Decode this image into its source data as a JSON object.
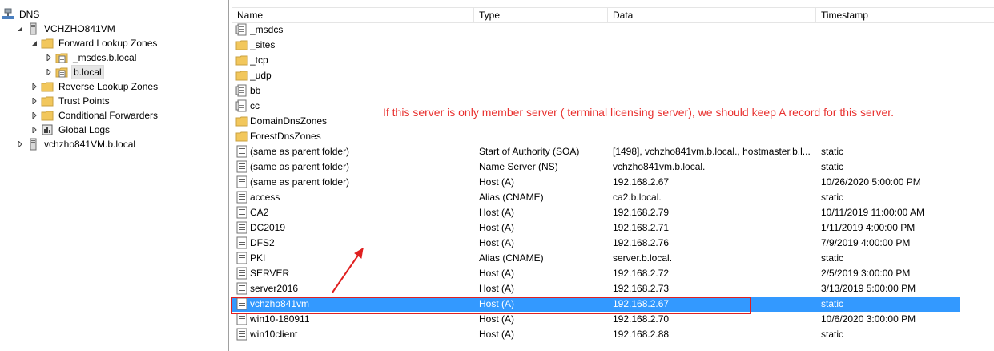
{
  "tree": {
    "root": "DNS",
    "server": "VCHZHO841VM",
    "forward_zones": "Forward Lookup Zones",
    "zone_msdcs": "_msdcs.b.local",
    "zone_blocal": "b.local",
    "reverse_zones": "Reverse Lookup Zones",
    "trust_points": "Trust Points",
    "conditional_forwarders": "Conditional Forwarders",
    "global_logs": "Global Logs",
    "other_server": "vchzho841VM.b.local"
  },
  "columns": {
    "name": "Name",
    "type": "Type",
    "data": "Data",
    "timestamp": "Timestamp"
  },
  "records": [
    {
      "name": "_msdcs",
      "type": "",
      "data": "",
      "timestamp": "",
      "icon": "zone-icon"
    },
    {
      "name": "_sites",
      "type": "",
      "data": "",
      "timestamp": "",
      "icon": "folder-icon"
    },
    {
      "name": "_tcp",
      "type": "",
      "data": "",
      "timestamp": "",
      "icon": "folder-icon"
    },
    {
      "name": "_udp",
      "type": "",
      "data": "",
      "timestamp": "",
      "icon": "folder-icon"
    },
    {
      "name": "bb",
      "type": "",
      "data": "",
      "timestamp": "",
      "icon": "zone-icon"
    },
    {
      "name": "cc",
      "type": "",
      "data": "",
      "timestamp": "",
      "icon": "zone-icon"
    },
    {
      "name": "DomainDnsZones",
      "type": "",
      "data": "",
      "timestamp": "",
      "icon": "folder-icon"
    },
    {
      "name": "ForestDnsZones",
      "type": "",
      "data": "",
      "timestamp": "",
      "icon": "folder-icon"
    },
    {
      "name": "(same as parent folder)",
      "type": "Start of Authority (SOA)",
      "data": "[1498], vchzho841vm.b.local., hostmaster.b.l...",
      "timestamp": "static",
      "icon": "record-icon"
    },
    {
      "name": "(same as parent folder)",
      "type": "Name Server (NS)",
      "data": "vchzho841vm.b.local.",
      "timestamp": "static",
      "icon": "record-icon"
    },
    {
      "name": "(same as parent folder)",
      "type": "Host (A)",
      "data": "192.168.2.67",
      "timestamp": "10/26/2020 5:00:00 PM",
      "icon": "record-icon"
    },
    {
      "name": "access",
      "type": "Alias (CNAME)",
      "data": "ca2.b.local.",
      "timestamp": "static",
      "icon": "record-icon"
    },
    {
      "name": "CA2",
      "type": "Host (A)",
      "data": "192.168.2.79",
      "timestamp": "10/11/2019 11:00:00 AM",
      "icon": "record-icon"
    },
    {
      "name": "DC2019",
      "type": "Host (A)",
      "data": "192.168.2.71",
      "timestamp": "1/11/2019 4:00:00 PM",
      "icon": "record-icon"
    },
    {
      "name": "DFS2",
      "type": "Host (A)",
      "data": "192.168.2.76",
      "timestamp": "7/9/2019 4:00:00 PM",
      "icon": "record-icon"
    },
    {
      "name": "PKI",
      "type": "Alias (CNAME)",
      "data": "server.b.local.",
      "timestamp": "static",
      "icon": "record-icon"
    },
    {
      "name": "SERVER",
      "type": "Host (A)",
      "data": "192.168.2.72",
      "timestamp": "2/5/2019 3:00:00 PM",
      "icon": "record-icon"
    },
    {
      "name": "server2016",
      "type": "Host (A)",
      "data": "192.168.2.73",
      "timestamp": "3/13/2019 5:00:00 PM",
      "icon": "record-icon"
    },
    {
      "name": "vchzho841vm",
      "type": "Host (A)",
      "data": "192.168.2.67",
      "timestamp": "static",
      "icon": "record-icon",
      "selected": true
    },
    {
      "name": "win10-180911",
      "type": "Host (A)",
      "data": "192.168.2.70",
      "timestamp": "10/6/2020 3:00:00 PM",
      "icon": "record-icon"
    },
    {
      "name": "win10client",
      "type": "Host (A)",
      "data": "192.168.2.88",
      "timestamp": "static",
      "icon": "record-icon"
    }
  ],
  "annotation": "If this server is only member server ( terminal licensing server), we should keep A record for this server.",
  "colors": {
    "selection": "#3399ff",
    "annotation": "#e8312f",
    "folder": "#f2c75c"
  }
}
